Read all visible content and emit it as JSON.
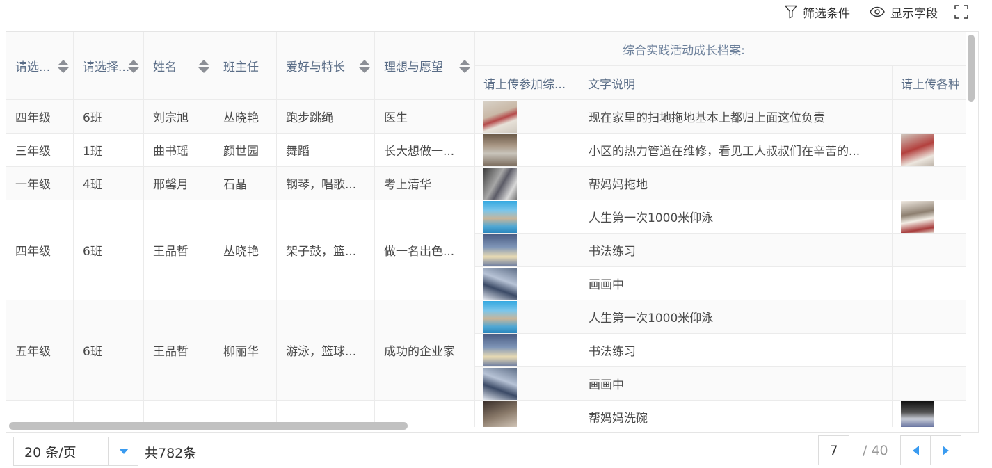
{
  "toolbar": {
    "filter_label": "筛选条件",
    "fields_label": "显示字段"
  },
  "table": {
    "columns": [
      "请选...",
      "请选择...",
      "姓名",
      "班主任",
      "爱好与特长",
      "理想与愿望"
    ],
    "group_header": "综合实践活动成长档案:",
    "sub_columns": [
      "请上传参加综...",
      "文字说明",
      "请上传各种"
    ],
    "rows": [
      {
        "grade": "四年级",
        "class": "6班",
        "name": "刘宗旭",
        "teacher": "丛晓艳",
        "hobby": "跑步跳绳",
        "ideal": "医生",
        "activities": [
          {
            "desc": "现在家里的扫地拖地基本上都归上面这位负责"
          }
        ]
      },
      {
        "grade": "三年级",
        "class": "1班",
        "name": "曲书瑶",
        "teacher": "颜世园",
        "hobby": "舞蹈",
        "ideal": "长大想做一...",
        "activities": [
          {
            "desc": "小区的热力管道在维修，看见工人叔叔们在辛苦的..."
          }
        ]
      },
      {
        "grade": "一年级",
        "class": "4班",
        "name": "邢馨月",
        "teacher": "石晶",
        "hobby": "钢琴，唱歌...",
        "ideal": "考上清华",
        "activities": [
          {
            "desc": "帮妈妈拖地"
          }
        ]
      },
      {
        "grade": "四年级",
        "class": "6班",
        "name": "王品哲",
        "teacher": "丛晓艳",
        "hobby": "架子鼓，篮...",
        "ideal": "做一名出色...",
        "activities": [
          {
            "desc": "人生第一次1000米仰泳"
          },
          {
            "desc": "书法练习"
          },
          {
            "desc": "画画中"
          }
        ]
      },
      {
        "grade": "五年级",
        "class": "6班",
        "name": "王品哲",
        "teacher": "柳丽华",
        "hobby": "游泳，篮球...",
        "ideal": "成功的企业家",
        "activities": [
          {
            "desc": "人生第一次1000米仰泳"
          },
          {
            "desc": "书法练习"
          },
          {
            "desc": "画画中"
          }
        ]
      },
      {
        "activities": [
          {
            "desc": "帮妈妈洗碗"
          }
        ]
      }
    ]
  },
  "pager": {
    "page_size": "20 条/页",
    "total": "共782条",
    "current_page": "7",
    "total_pages": "/ 40"
  }
}
